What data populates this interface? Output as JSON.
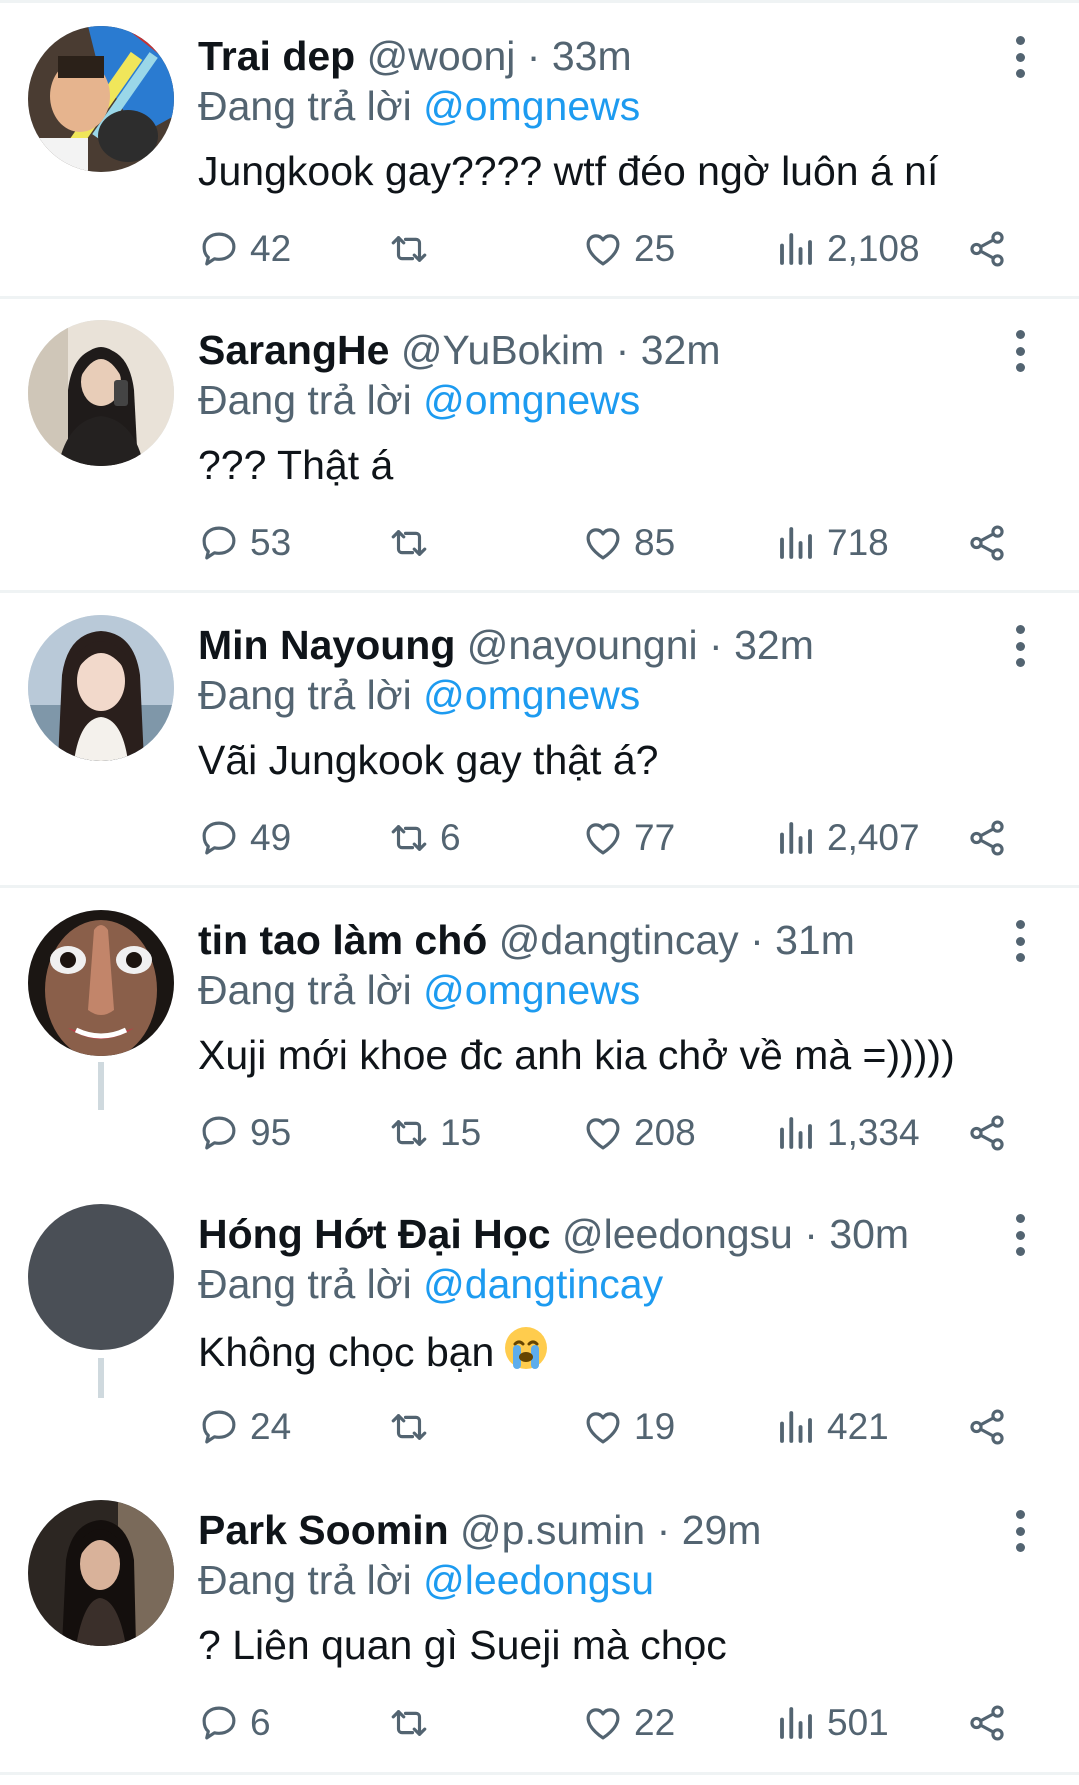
{
  "tweets": [
    {
      "name": "Trai dep",
      "handle": "@woonj",
      "time": "33m",
      "reply_prefix": "Đang trả lời",
      "reply_to": "@omgnews",
      "text": "Jungkook gay???? wtf đéo ngờ luôn á ní",
      "replies": "42",
      "retweets": "",
      "likes": "25",
      "views": "2,108",
      "avatar": "photo-selfie"
    },
    {
      "name": "SarangHe",
      "handle": "@YuBokim",
      "time": "32m",
      "reply_prefix": "Đang trả lời",
      "reply_to": "@omgnews",
      "text": "??? Thật á",
      "replies": "53",
      "retweets": "",
      "likes": "85",
      "views": "718",
      "avatar": "photo-mirror-selfie"
    },
    {
      "name": "Min Nayoung",
      "handle": "@nayoungni",
      "time": "32m",
      "reply_prefix": "Đang trả lời",
      "reply_to": "@omgnews",
      "text": "Vãi Jungkook gay thật á?",
      "replies": "49",
      "retweets": "6",
      "likes": "77",
      "views": "2,407",
      "avatar": "photo-portrait"
    },
    {
      "name": "tin tao làm chó",
      "handle": "@dangtincay",
      "time": "31m",
      "reply_prefix": "Đang trả lời",
      "reply_to": "@omgnews",
      "text": "Xuji mới khoe đc anh kia chở về mà =)))))",
      "replies": "95",
      "retweets": "15",
      "likes": "208",
      "views": "1,334",
      "avatar": "photo-face-closeup"
    },
    {
      "name": "Hóng Hớt Đại Học",
      "handle": "@leedongsu",
      "time": "30m",
      "reply_prefix": "Đang trả lời",
      "reply_to": "@dangtincay",
      "text": "Không chọc bạn",
      "emoji": "loudly-crying-face-emoji",
      "replies": "24",
      "retweets": "",
      "likes": "19",
      "views": "421",
      "avatar": "default-gray"
    },
    {
      "name": "Park Soomin",
      "handle": "@p.sumin",
      "time": "29m",
      "reply_prefix": "Đang trả lời",
      "reply_to": "@leedongsu",
      "text": "? Liên quan gì Sueji mà chọc",
      "replies": "6",
      "retweets": "",
      "likes": "22",
      "views": "501",
      "avatar": "photo-portrait-dark"
    }
  ],
  "separator": "·",
  "colors": {
    "text": "#0f1419",
    "muted": "#536471",
    "link": "#1d9bf0",
    "divider": "#eff3f4",
    "thread": "#cfd9de"
  },
  "icons": [
    "comment-icon",
    "retweet-icon",
    "heart-icon",
    "views-icon",
    "share-icon",
    "more-options-icon"
  ]
}
